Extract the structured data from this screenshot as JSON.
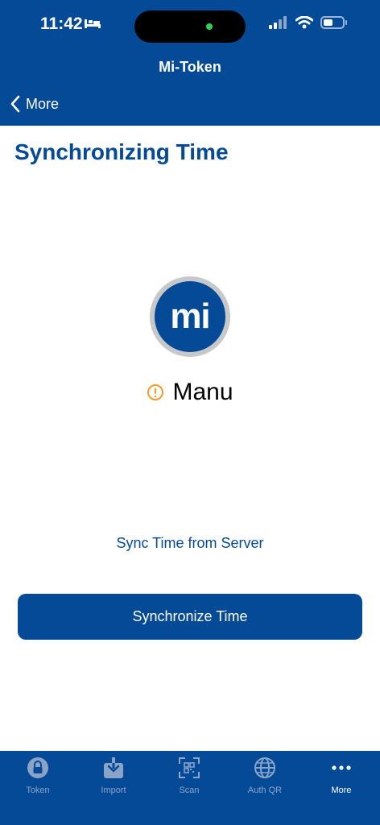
{
  "status_bar": {
    "time": "11:42"
  },
  "header": {
    "title": "Mi-Token",
    "back_label": "More"
  },
  "page": {
    "title": "Synchronizing Time"
  },
  "logo": {
    "text": "mi"
  },
  "user": {
    "name": "Manu",
    "status": "warning"
  },
  "sync": {
    "caption": "Sync Time from Server",
    "button_label": "Synchronize Time"
  },
  "tabs": [
    {
      "label": "Token",
      "icon": "lock-icon"
    },
    {
      "label": "Import",
      "icon": "import-icon"
    },
    {
      "label": "Scan",
      "icon": "qr-scan-icon"
    },
    {
      "label": "Auth QR",
      "icon": "globe-icon"
    },
    {
      "label": "More",
      "icon": "more-icon",
      "active": true
    }
  ],
  "colors": {
    "brand": "#054a97",
    "warning": "#f39a2b",
    "tab_inactive": "#8aa4c8"
  }
}
